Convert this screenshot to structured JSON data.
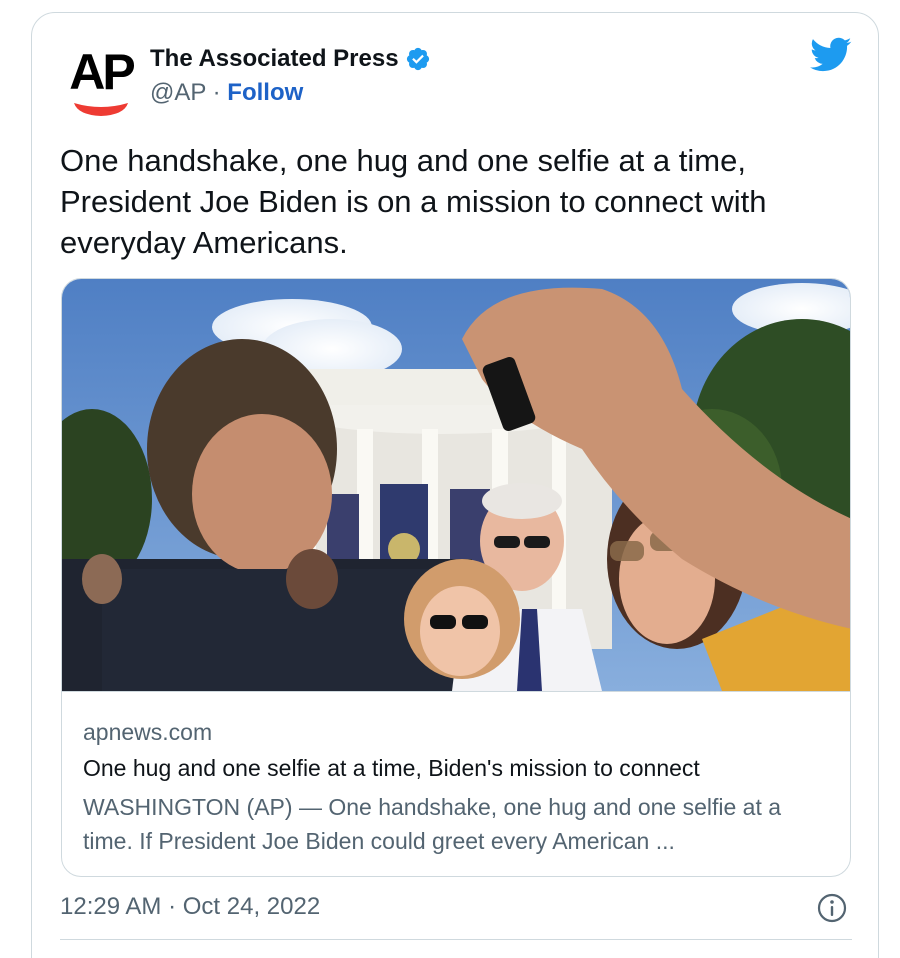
{
  "author": {
    "avatar_text": "AP",
    "name": "The Associated Press",
    "handle": "@AP",
    "separator": "·",
    "follow_label": "Follow"
  },
  "brand_icon": "twitter-bird-icon",
  "tweet": {
    "text": "One handshake, one hug and one selfie at a time, President Joe Biden is on a mission to connect with everyday Americans."
  },
  "link_card": {
    "image": "photo: man taking a selfie with President Joe Biden and supporters outside the White House",
    "domain": "apnews.com",
    "title": "One hug and one selfie at a time, Biden's mission to connect",
    "description": "WASHINGTON (AP) — One handshake, one hug and one selfie at a time. If President Joe Biden could greet every American ..."
  },
  "footer": {
    "time": "12:29 AM",
    "separator": "·",
    "date": "Oct 24, 2022",
    "info_icon": "info-icon"
  },
  "colors": {
    "follow_blue": "#1d62c7",
    "twitter_blue": "#1d9bf0",
    "ap_red": "#ee3b33",
    "secondary_text": "#536471",
    "border": "#cfd9de"
  }
}
